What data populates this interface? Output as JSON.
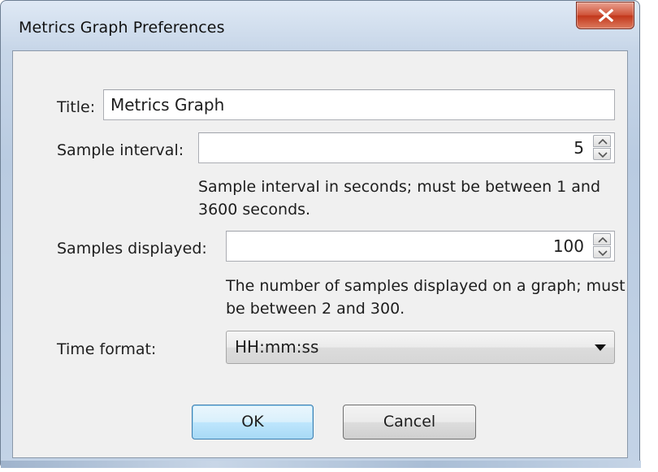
{
  "window": {
    "title": "Metrics Graph Preferences",
    "close_glyph": "X",
    "accent_color": "#c2371b"
  },
  "form": {
    "title": {
      "label": "Title:",
      "value": "Metrics Graph"
    },
    "sample_interval": {
      "label": "Sample interval:",
      "value": "5",
      "help": "Sample interval in seconds; must be between 1 and 3600 seconds."
    },
    "samples_displayed": {
      "label": "Samples displayed:",
      "value": "100",
      "help": "The number of samples displayed on a graph; must be between 2 and 300."
    },
    "time_format": {
      "label": "Time format:",
      "selected": "HH:mm:ss"
    }
  },
  "buttons": {
    "ok": "OK",
    "cancel": "Cancel"
  },
  "icons": {
    "close": "close-icon",
    "spin_up": "chevron-up-icon",
    "spin_down": "chevron-down-icon",
    "dropdown": "caret-down-icon"
  }
}
